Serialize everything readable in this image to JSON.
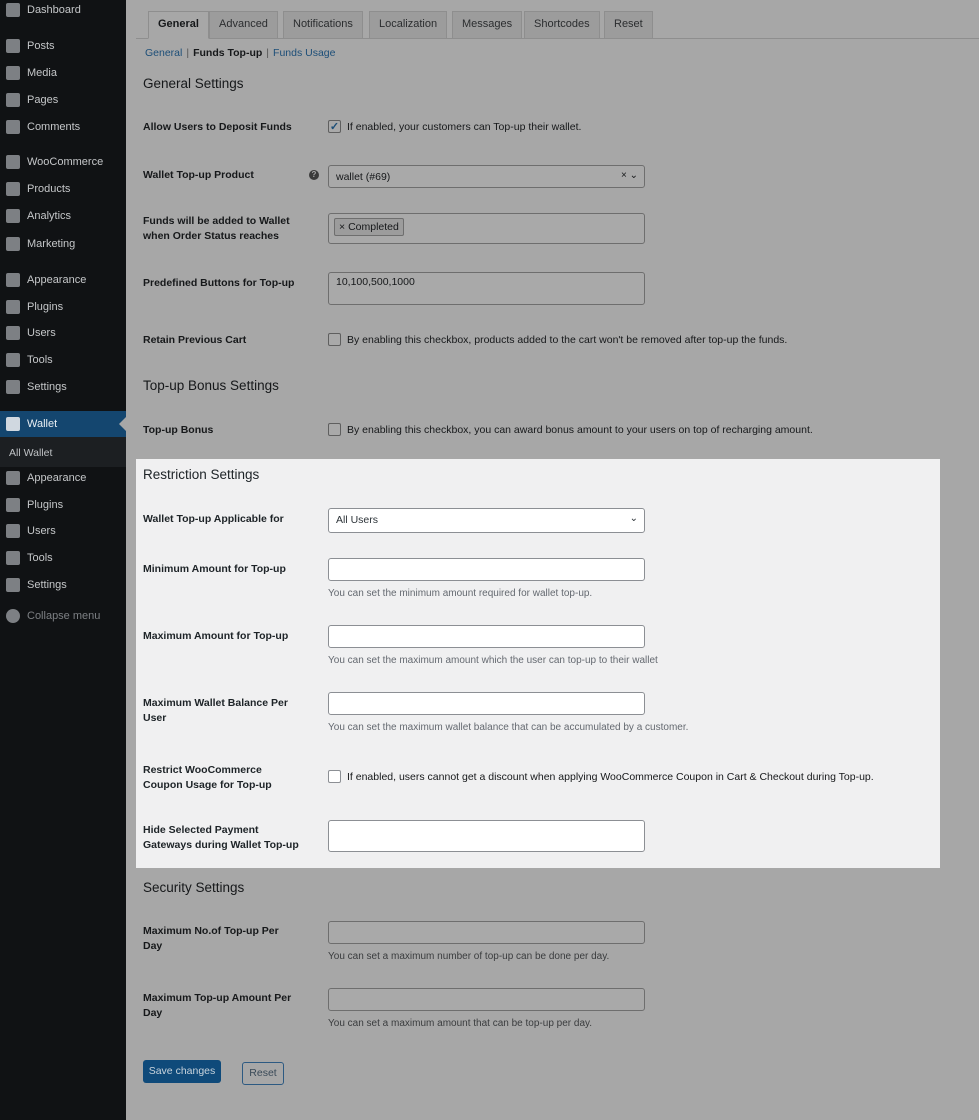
{
  "sidebar": {
    "items": [
      {
        "label": "Dashboard",
        "icon": "dashboard-icon"
      },
      {
        "label": "Posts",
        "icon": "pin-icon"
      },
      {
        "label": "Media",
        "icon": "media-icon"
      },
      {
        "label": "Pages",
        "icon": "pages-icon"
      },
      {
        "label": "Comments",
        "icon": "comment-icon"
      },
      {
        "label": "WooCommerce",
        "icon": "woo-icon"
      },
      {
        "label": "Products",
        "icon": "archive-icon"
      },
      {
        "label": "Analytics",
        "icon": "bar-chart-icon"
      },
      {
        "label": "Marketing",
        "icon": "megaphone-icon"
      },
      {
        "label": "Appearance",
        "icon": "brush-icon"
      },
      {
        "label": "Plugins",
        "icon": "plugin-icon"
      },
      {
        "label": "Users",
        "icon": "user-icon"
      },
      {
        "label": "Tools",
        "icon": "wrench-icon"
      },
      {
        "label": "Settings",
        "icon": "settings-icon"
      },
      {
        "label": "Wallet",
        "icon": "wallet-icon"
      },
      {
        "label": "Appearance",
        "icon": "brush-icon"
      },
      {
        "label": "Plugins",
        "icon": "plugin-icon"
      },
      {
        "label": "Users",
        "icon": "user-icon"
      },
      {
        "label": "Tools",
        "icon": "wrench-icon"
      },
      {
        "label": "Settings",
        "icon": "settings-icon"
      }
    ],
    "submenu": "All Wallet",
    "collapse": "Collapse menu"
  },
  "tabs": [
    "General",
    "Advanced",
    "Notifications",
    "Localization",
    "Messages",
    "Shortcodes",
    "Reset"
  ],
  "subnav": [
    "General",
    "Funds Top-up",
    "Funds Usage"
  ],
  "general": {
    "title": "General Settings",
    "allow_label": "Allow Users to Deposit Funds",
    "allow_text": "If enabled, your customers can Top-up their wallet.",
    "allow_checked": true,
    "product_label": "Wallet Top-up Product",
    "product_value": "wallet (#69)",
    "status_label": "Funds will be added to Wallet when Order Status reaches",
    "status_tag": "Completed",
    "predefined_label": "Predefined Buttons for Top-up",
    "predefined_value": "10,100,500,1000",
    "retain_label": "Retain Previous Cart",
    "retain_text": "By enabling this checkbox, products added to the cart won't be removed after top-up the funds."
  },
  "bonus": {
    "title": "Top-up Bonus Settings",
    "label": "Top-up Bonus",
    "text": "By enabling this checkbox, you can award bonus amount to your users on top of recharging amount."
  },
  "restriction": {
    "title": "Restriction Settings",
    "applicable_label": "Wallet Top-up Applicable for",
    "applicable_value": "All Users",
    "min_label": "Minimum Amount for Top-up",
    "min_desc": "You can set the minimum amount required for wallet top-up.",
    "max_label": "Maximum Amount for Top-up",
    "max_desc": "You can set the maximum amount which the user can top-up to their wallet",
    "balance_label": "Maximum Wallet Balance Per User",
    "balance_desc": "You can set the maximum wallet balance that can be accumulated by a customer.",
    "coupon_label": "Restrict WooCommerce Coupon Usage for Top-up",
    "coupon_text": "If enabled, users cannot get a discount when applying WooCommerce Coupon in Cart & Checkout during Top-up.",
    "gateways_label": "Hide Selected Payment Gateways during Wallet Top-up"
  },
  "security": {
    "title": "Security Settings",
    "count_label": "Maximum No.of Top-up Per Day",
    "count_desc": "You can set a maximum number of top-up can be done per day.",
    "amount_label": "Maximum Top-up Amount Per Day",
    "amount_desc": "You can set a maximum amount that can be top-up per day."
  },
  "buttons": {
    "save": "Save changes",
    "reset": "Reset"
  }
}
